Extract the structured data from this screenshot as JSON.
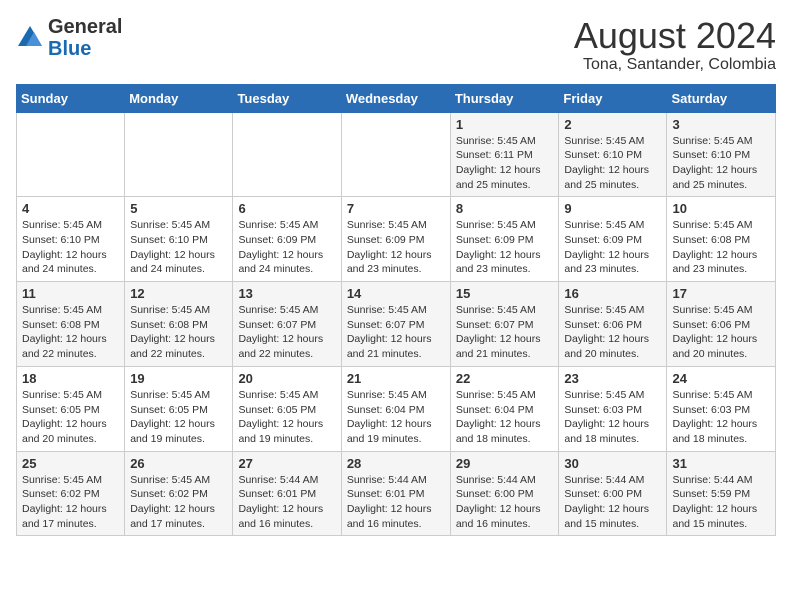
{
  "logo": {
    "general": "General",
    "blue": "Blue"
  },
  "title": {
    "month_year": "August 2024",
    "location": "Tona, Santander, Colombia"
  },
  "headers": [
    "Sunday",
    "Monday",
    "Tuesday",
    "Wednesday",
    "Thursday",
    "Friday",
    "Saturday"
  ],
  "weeks": [
    [
      {
        "day": "",
        "info": ""
      },
      {
        "day": "",
        "info": ""
      },
      {
        "day": "",
        "info": ""
      },
      {
        "day": "",
        "info": ""
      },
      {
        "day": "1",
        "info": "Sunrise: 5:45 AM\nSunset: 6:11 PM\nDaylight: 12 hours\nand 25 minutes."
      },
      {
        "day": "2",
        "info": "Sunrise: 5:45 AM\nSunset: 6:10 PM\nDaylight: 12 hours\nand 25 minutes."
      },
      {
        "day": "3",
        "info": "Sunrise: 5:45 AM\nSunset: 6:10 PM\nDaylight: 12 hours\nand 25 minutes."
      }
    ],
    [
      {
        "day": "4",
        "info": "Sunrise: 5:45 AM\nSunset: 6:10 PM\nDaylight: 12 hours\nand 24 minutes."
      },
      {
        "day": "5",
        "info": "Sunrise: 5:45 AM\nSunset: 6:10 PM\nDaylight: 12 hours\nand 24 minutes."
      },
      {
        "day": "6",
        "info": "Sunrise: 5:45 AM\nSunset: 6:09 PM\nDaylight: 12 hours\nand 24 minutes."
      },
      {
        "day": "7",
        "info": "Sunrise: 5:45 AM\nSunset: 6:09 PM\nDaylight: 12 hours\nand 23 minutes."
      },
      {
        "day": "8",
        "info": "Sunrise: 5:45 AM\nSunset: 6:09 PM\nDaylight: 12 hours\nand 23 minutes."
      },
      {
        "day": "9",
        "info": "Sunrise: 5:45 AM\nSunset: 6:09 PM\nDaylight: 12 hours\nand 23 minutes."
      },
      {
        "day": "10",
        "info": "Sunrise: 5:45 AM\nSunset: 6:08 PM\nDaylight: 12 hours\nand 23 minutes."
      }
    ],
    [
      {
        "day": "11",
        "info": "Sunrise: 5:45 AM\nSunset: 6:08 PM\nDaylight: 12 hours\nand 22 minutes."
      },
      {
        "day": "12",
        "info": "Sunrise: 5:45 AM\nSunset: 6:08 PM\nDaylight: 12 hours\nand 22 minutes."
      },
      {
        "day": "13",
        "info": "Sunrise: 5:45 AM\nSunset: 6:07 PM\nDaylight: 12 hours\nand 22 minutes."
      },
      {
        "day": "14",
        "info": "Sunrise: 5:45 AM\nSunset: 6:07 PM\nDaylight: 12 hours\nand 21 minutes."
      },
      {
        "day": "15",
        "info": "Sunrise: 5:45 AM\nSunset: 6:07 PM\nDaylight: 12 hours\nand 21 minutes."
      },
      {
        "day": "16",
        "info": "Sunrise: 5:45 AM\nSunset: 6:06 PM\nDaylight: 12 hours\nand 20 minutes."
      },
      {
        "day": "17",
        "info": "Sunrise: 5:45 AM\nSunset: 6:06 PM\nDaylight: 12 hours\nand 20 minutes."
      }
    ],
    [
      {
        "day": "18",
        "info": "Sunrise: 5:45 AM\nSunset: 6:05 PM\nDaylight: 12 hours\nand 20 minutes."
      },
      {
        "day": "19",
        "info": "Sunrise: 5:45 AM\nSunset: 6:05 PM\nDaylight: 12 hours\nand 19 minutes."
      },
      {
        "day": "20",
        "info": "Sunrise: 5:45 AM\nSunset: 6:05 PM\nDaylight: 12 hours\nand 19 minutes."
      },
      {
        "day": "21",
        "info": "Sunrise: 5:45 AM\nSunset: 6:04 PM\nDaylight: 12 hours\nand 19 minutes."
      },
      {
        "day": "22",
        "info": "Sunrise: 5:45 AM\nSunset: 6:04 PM\nDaylight: 12 hours\nand 18 minutes."
      },
      {
        "day": "23",
        "info": "Sunrise: 5:45 AM\nSunset: 6:03 PM\nDaylight: 12 hours\nand 18 minutes."
      },
      {
        "day": "24",
        "info": "Sunrise: 5:45 AM\nSunset: 6:03 PM\nDaylight: 12 hours\nand 18 minutes."
      }
    ],
    [
      {
        "day": "25",
        "info": "Sunrise: 5:45 AM\nSunset: 6:02 PM\nDaylight: 12 hours\nand 17 minutes."
      },
      {
        "day": "26",
        "info": "Sunrise: 5:45 AM\nSunset: 6:02 PM\nDaylight: 12 hours\nand 17 minutes."
      },
      {
        "day": "27",
        "info": "Sunrise: 5:44 AM\nSunset: 6:01 PM\nDaylight: 12 hours\nand 16 minutes."
      },
      {
        "day": "28",
        "info": "Sunrise: 5:44 AM\nSunset: 6:01 PM\nDaylight: 12 hours\nand 16 minutes."
      },
      {
        "day": "29",
        "info": "Sunrise: 5:44 AM\nSunset: 6:00 PM\nDaylight: 12 hours\nand 16 minutes."
      },
      {
        "day": "30",
        "info": "Sunrise: 5:44 AM\nSunset: 6:00 PM\nDaylight: 12 hours\nand 15 minutes."
      },
      {
        "day": "31",
        "info": "Sunrise: 5:44 AM\nSunset: 5:59 PM\nDaylight: 12 hours\nand 15 minutes."
      }
    ]
  ]
}
